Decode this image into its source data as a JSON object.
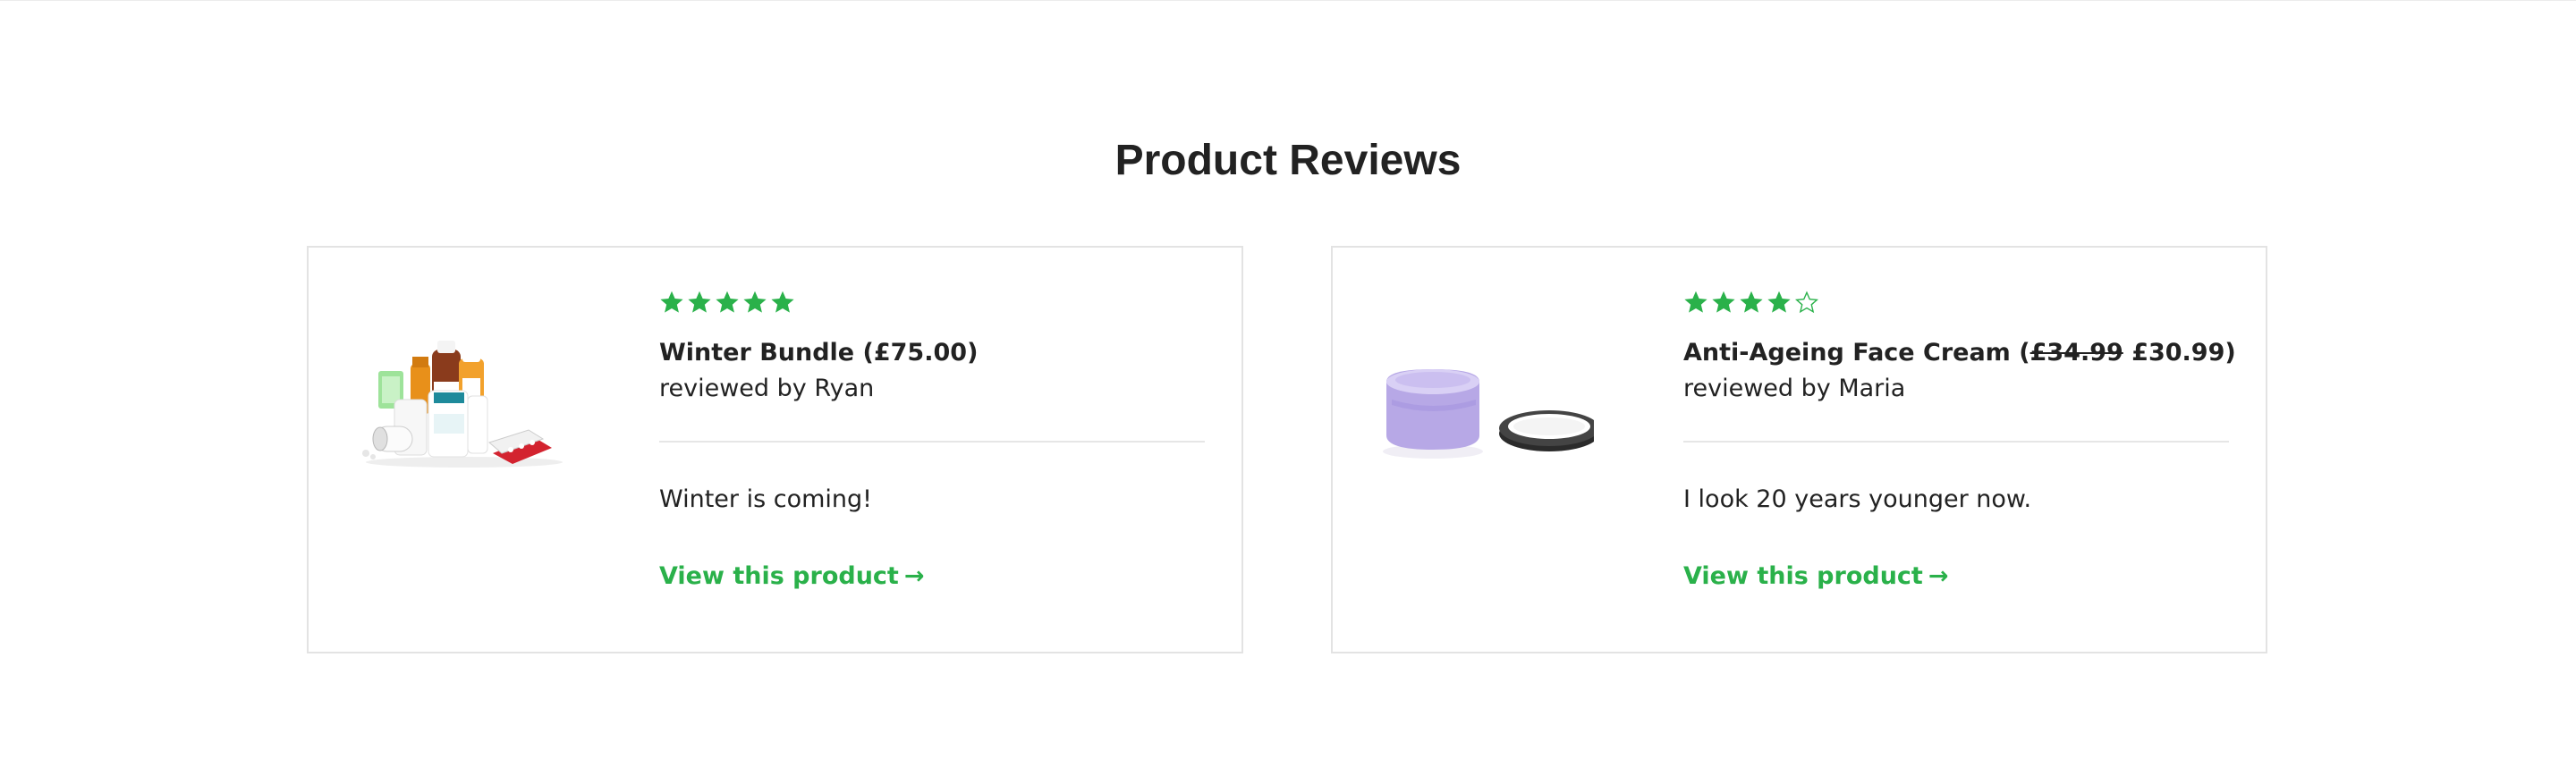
{
  "section": {
    "title": "Product Reviews"
  },
  "reviews": [
    {
      "rating": 5,
      "max_rating": 5,
      "product_name": "Winter Bundle",
      "open_paren": " (",
      "old_price": "",
      "price": "£75.00",
      "close_paren": ")",
      "reviewer_prefix": "reviewed by",
      "reviewer": "Ryan",
      "text": "Winter is coming!",
      "link_label": "View this product",
      "link_arrow": "→",
      "image_icon": "medicine-bottles-image"
    },
    {
      "rating": 4,
      "max_rating": 5,
      "product_name": "Anti-Ageing Face Cream",
      "open_paren": " (",
      "old_price": "£34.99",
      "price": "£30.99",
      "close_paren": ")",
      "reviewer_prefix": "reviewed by",
      "reviewer": "Maria",
      "text": "I look 20 years younger now.",
      "link_label": "View this product",
      "link_arrow": "→",
      "image_icon": "cream-jar-image"
    }
  ],
  "colors": {
    "accent": "#2ab14a",
    "text": "#222222",
    "border": "#e3e3e3"
  }
}
